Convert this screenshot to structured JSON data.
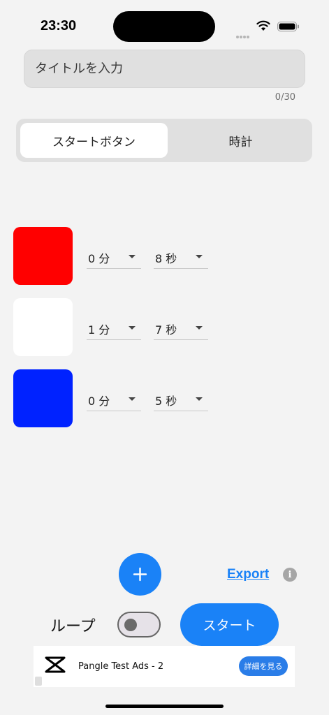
{
  "status_bar": {
    "time": "23:30"
  },
  "title_field": {
    "placeholder": "タイトルを入力",
    "value": "",
    "char_count": "0/30"
  },
  "mode_tabs": [
    {
      "label": "スタートボタン",
      "selected": true
    },
    {
      "label": "時計",
      "selected": false
    }
  ],
  "rows": [
    {
      "color": "#ff0000",
      "minutes": "0 分",
      "seconds": "8 秒"
    },
    {
      "color": "#ffffff",
      "minutes": "1 分",
      "seconds": "7 秒"
    },
    {
      "color": "#0022ff",
      "minutes": "0 分",
      "seconds": "5 秒"
    }
  ],
  "actions": {
    "export_label": "Export",
    "info_icon": "i"
  },
  "loop": {
    "label": "ループ",
    "enabled": false
  },
  "start_button": {
    "label": "スタート"
  },
  "ad": {
    "title": "Pangle Test Ads - 2",
    "cta": "詳細を見る",
    "badge": ""
  },
  "colors": {
    "accent": "#1a82f7",
    "background": "#f3f3f3"
  }
}
